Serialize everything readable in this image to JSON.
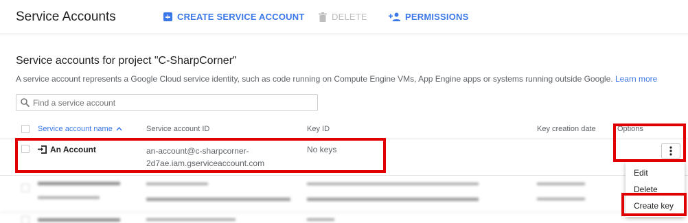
{
  "header": {
    "title": "Service Accounts",
    "create_label": "CREATE SERVICE ACCOUNT",
    "delete_label": "DELETE",
    "permissions_label": "PERMISSIONS"
  },
  "section": {
    "title": "Service accounts for project \"C-SharpCorner\"",
    "description": "A service account represents a Google Cloud service identity, such as code running on Compute Engine VMs, App Engine apps or systems running outside Google.",
    "learn_more": "Learn more"
  },
  "search": {
    "placeholder": "Find a service account"
  },
  "table": {
    "columns": {
      "name": "Service account name",
      "id": "Service account ID",
      "key_id": "Key ID",
      "key_date": "Key creation date",
      "options": "Options"
    },
    "rows": [
      {
        "name": "An Account",
        "id_line1": "an-account@c-sharpcorner-",
        "id_line2": "2d7ae.iam.gserviceaccount.com",
        "key_id": "No keys",
        "key_date": ""
      }
    ]
  },
  "menu": {
    "items": [
      "Edit",
      "Delete",
      "Create key"
    ]
  },
  "colors": {
    "accent": "#3b78e7",
    "highlight": "#e00000"
  }
}
